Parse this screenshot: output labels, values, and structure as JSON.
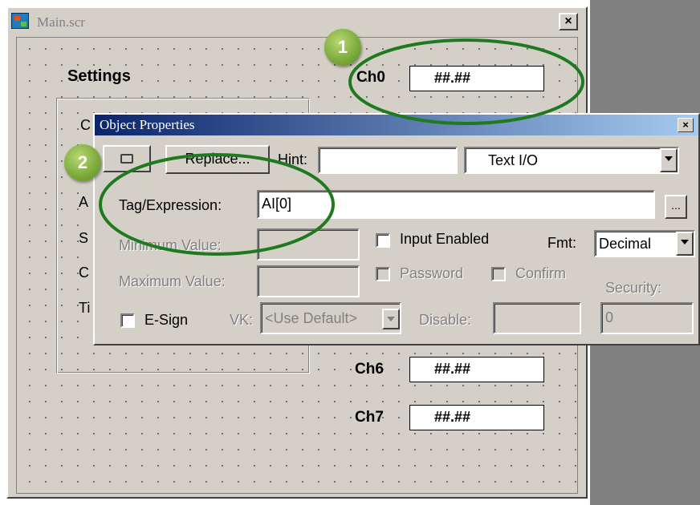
{
  "main_window": {
    "title": "Main.scr",
    "close_glyph": "×",
    "settings_label": "Settings",
    "group_letters": [
      "C",
      "A",
      "S",
      "C",
      "Ti"
    ],
    "channels": [
      {
        "label": "Ch0",
        "value": "##.##"
      },
      {
        "label": "Ch6",
        "value": "##.##"
      },
      {
        "label": "Ch7",
        "value": "##.##"
      }
    ]
  },
  "dialog": {
    "title": "Object Properties",
    "close_glyph": "×",
    "replace_button": "Replace...",
    "hint_label": "Hint:",
    "hint_value": "",
    "type_select": "Text I/O",
    "tag_label": "Tag/Expression:",
    "tag_value": "AI[0]",
    "browse_button": "...",
    "min_label": "Minimum Value:",
    "max_label": "Maximum Value:",
    "input_enabled_label": "Input Enabled",
    "input_enabled": false,
    "password_label": "Password",
    "confirm_label": "Confirm",
    "fmt_label": "Fmt:",
    "fmt_value": "Decimal",
    "security_label": "Security:",
    "security_value": "0",
    "esign_label": "E-Sign",
    "vk_label": "VK:",
    "vk_value": "<Use Default>",
    "disable_label": "Disable:"
  },
  "callouts": [
    {
      "number": "1",
      "color": "#1f7a1f"
    },
    {
      "number": "2",
      "color": "#1f7a1f"
    }
  ],
  "colors": {
    "face": "#d4d0c8",
    "title_active_start": "#0a246a",
    "title_active_end": "#a6caf0",
    "callout_ring": "#1f7a1f",
    "badge_green": "#7aa93a"
  }
}
